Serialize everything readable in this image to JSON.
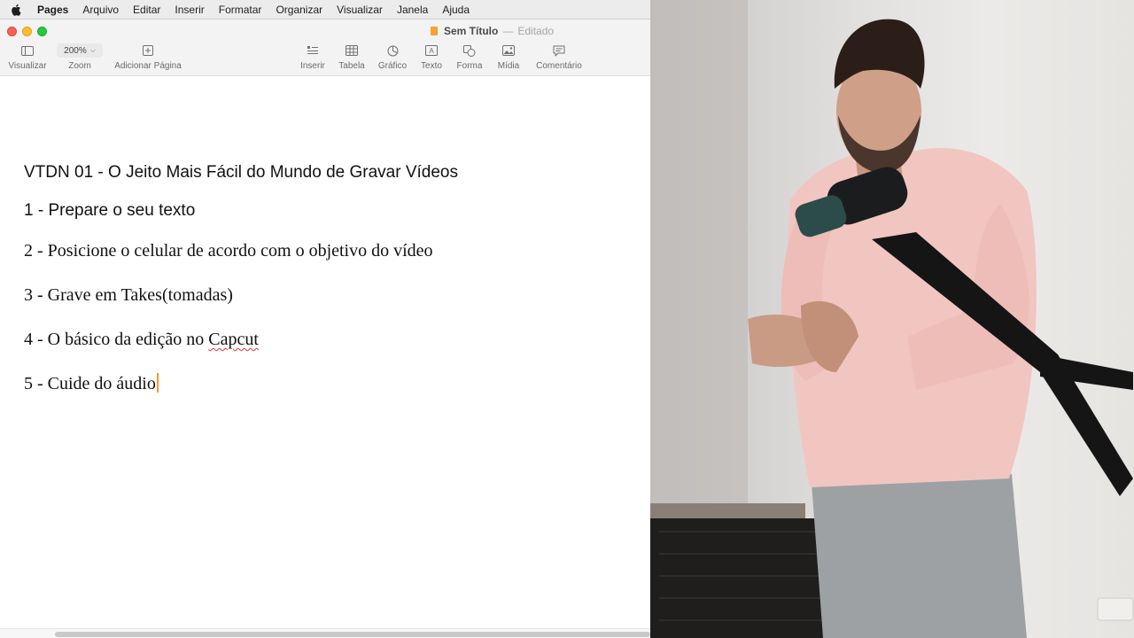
{
  "menubar": {
    "app_name": "Pages",
    "items": [
      "Arquivo",
      "Editar",
      "Inserir",
      "Formatar",
      "Organizar",
      "Visualizar",
      "Janela",
      "Ajuda"
    ]
  },
  "window": {
    "title": "Sem Título",
    "separator": "—",
    "status": "Editado"
  },
  "toolbar": {
    "view_label": "Visualizar",
    "zoom_value": "200%",
    "zoom_label": "Zoom",
    "add_page_label": "Adicionar Página",
    "insert_label": "Inserir",
    "table_label": "Tabela",
    "chart_label": "Gráfico",
    "text_label": "Texto",
    "shape_label": "Forma",
    "media_label": "Mídia",
    "comment_label": "Comentário"
  },
  "document": {
    "title": "VTDN 01 - O Jeito Mais Fácil do Mundo de Gravar Vídeos",
    "line1": "1 - Prepare o seu texto",
    "line2": "2 - Posicione o celular de acordo com o objetivo do vídeo",
    "line3": "3 - Grave em Takes(tomadas)",
    "line4_prefix": "4 - O básico da edição no ",
    "line4_misspelled": "Capcut",
    "line5": "5 - Cuide do áudio"
  },
  "colors": {
    "close": "#fe5f57",
    "minimize": "#febc2e",
    "maximize": "#28c840",
    "caret": "#f29a2e",
    "spellcheck": "#e0332d"
  }
}
